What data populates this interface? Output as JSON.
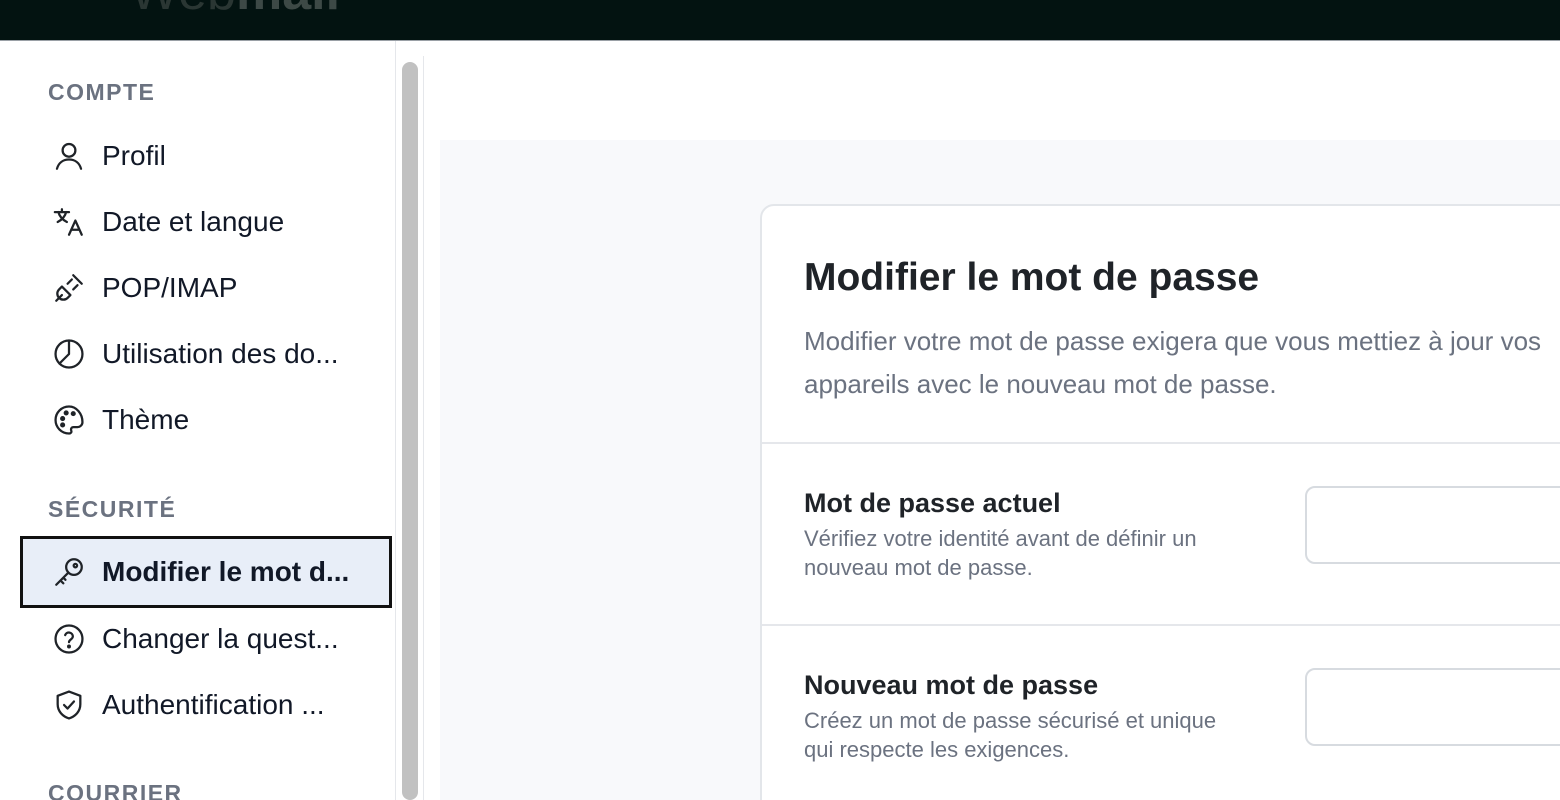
{
  "brand": {
    "thin": "Web",
    "bold": "mail"
  },
  "sidebar": {
    "sections": [
      {
        "title": "COMPTE"
      },
      {
        "title": "SÉCURITÉ"
      },
      {
        "title": "COURRIER"
      }
    ],
    "items": [
      {
        "label": "Profil",
        "icon": "user-icon"
      },
      {
        "label": "Date et langue",
        "icon": "translate-icon"
      },
      {
        "label": "POP/IMAP",
        "icon": "plug-icon"
      },
      {
        "label": "Utilisation des do...",
        "icon": "pie-chart-icon"
      },
      {
        "label": "Thème",
        "icon": "palette-icon"
      },
      {
        "label": "Modifier le mot d...",
        "icon": "key-icon",
        "active": true
      },
      {
        "label": "Changer la quest...",
        "icon": "question-circle-icon"
      },
      {
        "label": "Authentification ...",
        "icon": "shield-check-icon"
      }
    ]
  },
  "card": {
    "title": "Modifier le mot de passe",
    "description": "Modifier votre mot de passe exigera que vous mettiez à jour vos appareils avec le nouveau mot de passe.",
    "fields": [
      {
        "label": "Mot de passe actuel",
        "hint": "Vérifiez votre identité avant de définir un nouveau mot de passe.",
        "value": ""
      },
      {
        "label": "Nouveau mot de passe",
        "hint": "Créez un mot de passe sécurisé et unique qui respecte les exigences.",
        "value": ""
      }
    ]
  },
  "colors": {
    "topbar": "#031311",
    "active_bg": "#e8eef8",
    "muted_text": "#6b7280",
    "content_bg": "#f8f9fb"
  }
}
